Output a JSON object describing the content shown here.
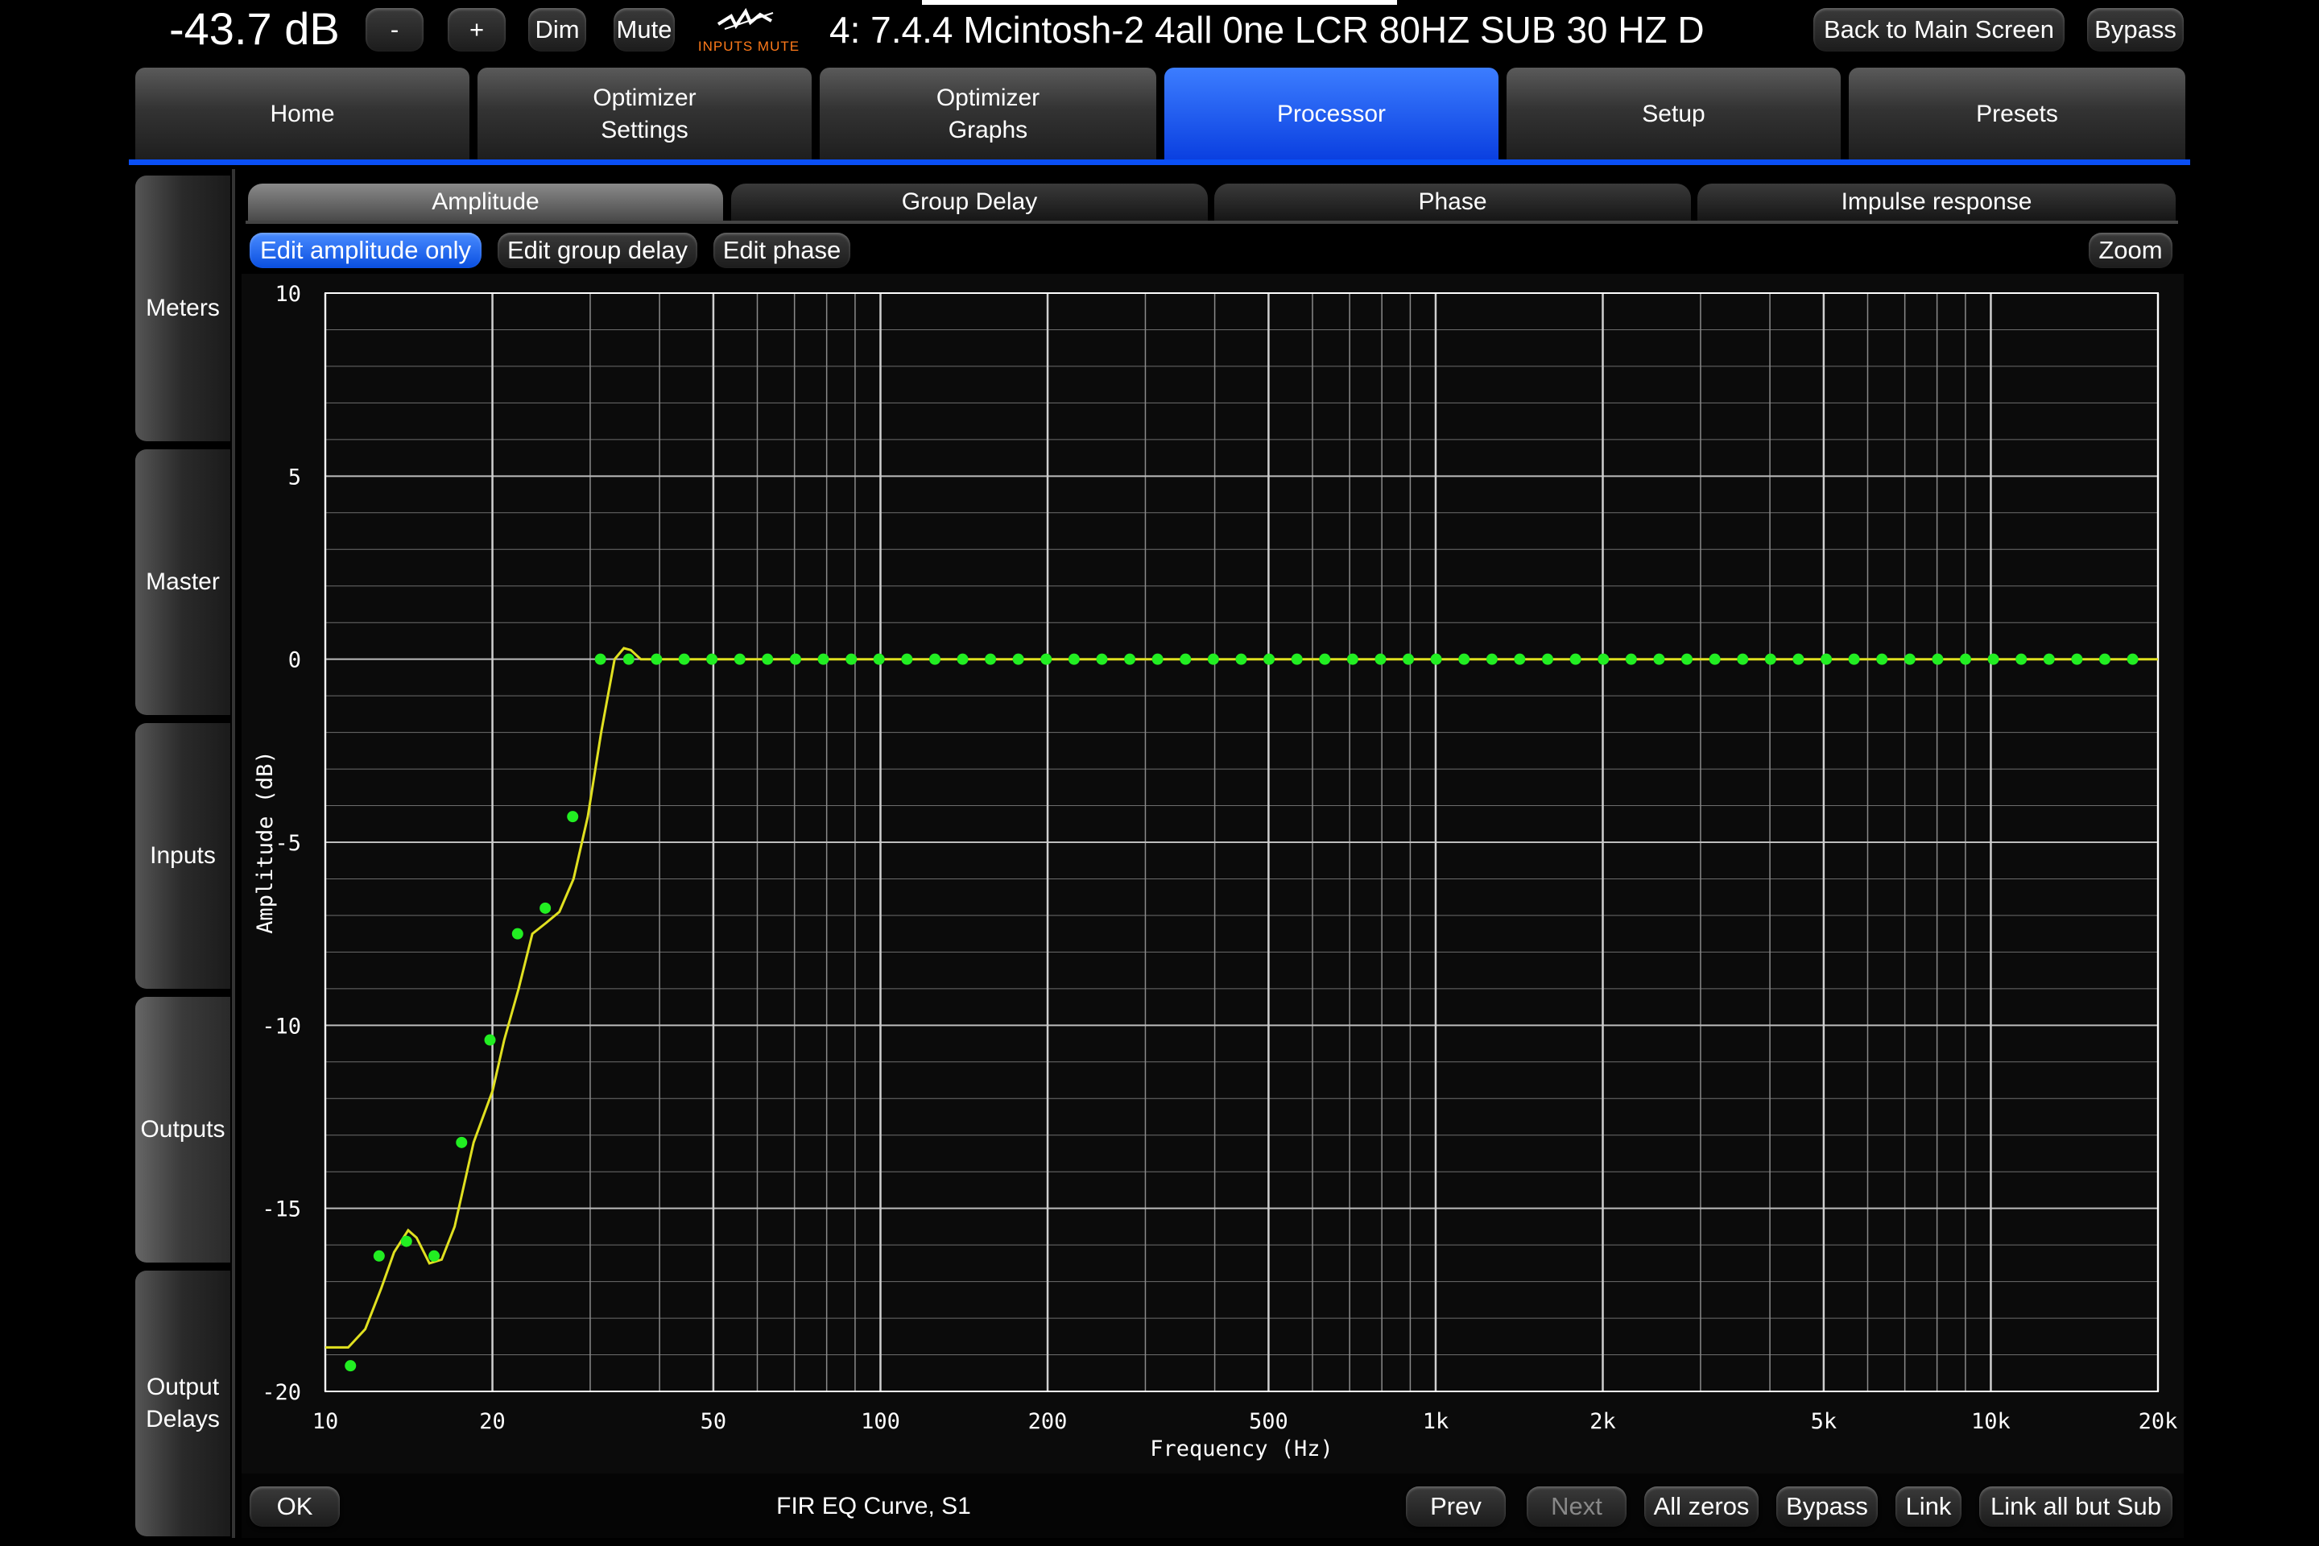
{
  "topbar": {
    "volume": "-43.7 dB",
    "minus_label": "-",
    "plus_label": "+",
    "dim_label": "Dim",
    "mute_label": "Mute",
    "inputs_mute_label": "INPUTS MUTE",
    "preset_title": "4: 7.4.4 Mcintosh-2 4all 0ne LCR 80HZ SUB 30 HZ D",
    "back_label": "Back to Main Screen",
    "bypass_label": "Bypass"
  },
  "main_tabs": [
    {
      "label": "Home"
    },
    {
      "label": "Optimizer Settings"
    },
    {
      "label": "Optimizer Graphs"
    },
    {
      "label": "Processor",
      "active": true
    },
    {
      "label": "Setup"
    },
    {
      "label": "Presets"
    }
  ],
  "side_tabs": [
    {
      "label": "Meters"
    },
    {
      "label": "Master"
    },
    {
      "label": "Inputs"
    },
    {
      "label": "Outputs",
      "active": true
    },
    {
      "label": "Output Delays"
    }
  ],
  "sub_tabs": [
    {
      "label": "Amplitude",
      "active": true
    },
    {
      "label": "Group Delay"
    },
    {
      "label": "Phase"
    },
    {
      "label": "Impulse response"
    }
  ],
  "edit_modes": [
    {
      "label": "Edit amplitude only",
      "active": true
    },
    {
      "label": "Edit group delay"
    },
    {
      "label": "Edit phase"
    }
  ],
  "zoom_label": "Zoom",
  "bottom": {
    "ok_label": "OK",
    "status": "FIR EQ Curve, S1",
    "prev_label": "Prev",
    "next_label": "Next",
    "all_zeros_label": "All zeros",
    "bypass_label": "Bypass",
    "link_label": "Link",
    "link_all_label": "Link all but Sub"
  },
  "colors": {
    "accent": "#0a4ff5",
    "curve": "#e0e020",
    "points": "#22ee22",
    "grid": "#8a8a8a"
  },
  "chart_data": {
    "type": "line",
    "xlabel": "Frequency (Hz)",
    "ylabel": "Amplitude (dB)",
    "xscale": "log",
    "xlim": [
      10,
      20000
    ],
    "ylim": [
      -20,
      10
    ],
    "grid": true,
    "x_ticks": [
      {
        "v": 10,
        "label": "10"
      },
      {
        "v": 20,
        "label": "20"
      },
      {
        "v": 50,
        "label": "50"
      },
      {
        "v": 100,
        "label": "100"
      },
      {
        "v": 200,
        "label": "200"
      },
      {
        "v": 500,
        "label": "500"
      },
      {
        "v": 1000,
        "label": "1k"
      },
      {
        "v": 2000,
        "label": "2k"
      },
      {
        "v": 5000,
        "label": "5k"
      },
      {
        "v": 10000,
        "label": "10k"
      },
      {
        "v": 20000,
        "label": "20k"
      }
    ],
    "y_ticks": [
      {
        "v": 10,
        "label": "10"
      },
      {
        "v": 5,
        "label": "5"
      },
      {
        "v": 0,
        "label": "0"
      },
      {
        "v": -5,
        "label": "-5"
      },
      {
        "v": -10,
        "label": "-10"
      },
      {
        "v": -15,
        "label": "-15"
      },
      {
        "v": -20,
        "label": "-20"
      }
    ],
    "series": [
      {
        "kind": "curve",
        "points": [
          [
            10,
            -18.8
          ],
          [
            11,
            -18.8
          ],
          [
            11.8,
            -18.3
          ],
          [
            12.6,
            -17.2
          ],
          [
            13.3,
            -16.2
          ],
          [
            14.1,
            -15.6
          ],
          [
            14.6,
            -15.8
          ],
          [
            15.4,
            -16.5
          ],
          [
            16.2,
            -16.4
          ],
          [
            17.1,
            -15.5
          ],
          [
            18.5,
            -13.2
          ],
          [
            20,
            -11.8
          ],
          [
            21,
            -10.4
          ],
          [
            22.3,
            -9
          ],
          [
            23.6,
            -7.5
          ],
          [
            25,
            -7.2
          ],
          [
            26.4,
            -6.9
          ],
          [
            28,
            -6
          ],
          [
            29.7,
            -4.3
          ],
          [
            31.4,
            -2
          ],
          [
            33.2,
            0
          ],
          [
            34.5,
            0.3
          ],
          [
            35.5,
            0.25
          ],
          [
            37,
            0
          ],
          [
            20000,
            0
          ]
        ]
      },
      {
        "kind": "points",
        "points": [
          [
            11.1,
            -19.3
          ],
          [
            12.5,
            -16.3
          ],
          [
            14.0,
            -15.9
          ],
          [
            15.7,
            -16.3
          ],
          [
            17.6,
            -13.2
          ],
          [
            19.8,
            -10.4
          ],
          [
            22.2,
            -7.5
          ],
          [
            24.9,
            -6.8
          ],
          [
            27.9,
            -4.3
          ],
          [
            31.3,
            0
          ],
          [
            35.2,
            0
          ],
          [
            39.5,
            0
          ],
          [
            44.3,
            0
          ],
          [
            49.7,
            0
          ],
          [
            55.8,
            0
          ],
          [
            62.6,
            0
          ],
          [
            70.3,
            0
          ],
          [
            78.9,
            0
          ],
          [
            88.6,
            0
          ],
          [
            99.4,
            0
          ],
          [
            111.6,
            0
          ],
          [
            125.3,
            0
          ],
          [
            140.6,
            0
          ],
          [
            157.8,
            0
          ],
          [
            177.1,
            0
          ],
          [
            198.8,
            0
          ],
          [
            223.2,
            0
          ],
          [
            250.5,
            0
          ],
          [
            281.2,
            0
          ],
          [
            315.6,
            0
          ],
          [
            354.3,
            0
          ],
          [
            397.7,
            0
          ],
          [
            446.4,
            0
          ],
          [
            501.1,
            0
          ],
          [
            562.5,
            0
          ],
          [
            631.4,
            0
          ],
          [
            708.7,
            0
          ],
          [
            795.5,
            0
          ],
          [
            892.9,
            0
          ],
          [
            1002,
            0
          ],
          [
            1125,
            0
          ],
          [
            1263,
            0
          ],
          [
            1417,
            0
          ],
          [
            1591,
            0
          ],
          [
            1786,
            0
          ],
          [
            2005,
            0
          ],
          [
            2250,
            0
          ],
          [
            2526,
            0
          ],
          [
            2835,
            0
          ],
          [
            3183,
            0
          ],
          [
            3573,
            0
          ],
          [
            4010,
            0
          ],
          [
            4501,
            0
          ],
          [
            5053,
            0
          ],
          [
            5671,
            0
          ],
          [
            6366,
            0
          ],
          [
            7146,
            0
          ],
          [
            8021,
            0
          ],
          [
            9003,
            0
          ],
          [
            10106,
            0
          ],
          [
            11343,
            0
          ],
          [
            12732,
            0
          ],
          [
            14292,
            0
          ],
          [
            16042,
            0
          ],
          [
            18007,
            0
          ]
        ]
      }
    ]
  }
}
